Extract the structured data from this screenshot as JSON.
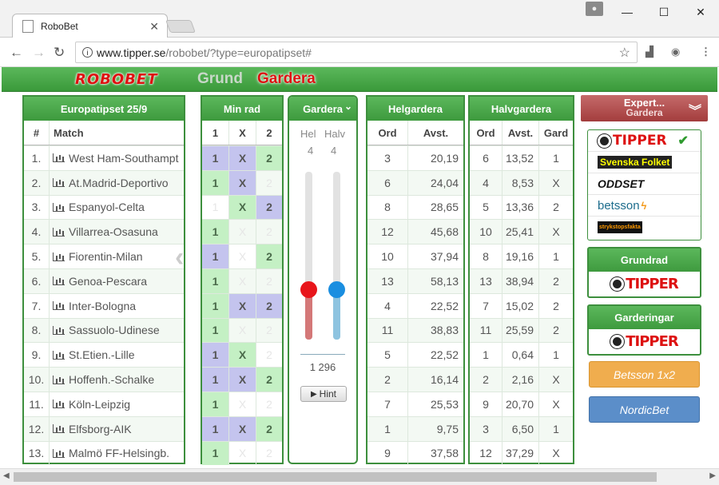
{
  "browser": {
    "tab_title": "RoboBet",
    "url_host": "www.tipper.se",
    "url_path": "/robobet/?type=europatipset#"
  },
  "header": {
    "logo": "ROBOBET",
    "mode_grund": "Grund",
    "mode_gardera": "Gardera"
  },
  "matches": {
    "title": "Europatipset 25/9",
    "col_num": "#",
    "col_match": "Match",
    "rows": [
      {
        "n": "1.",
        "m": "West Ham-Southampt"
      },
      {
        "n": "2.",
        "m": "At.Madrid-Deportivo"
      },
      {
        "n": "3.",
        "m": "Espanyol-Celta"
      },
      {
        "n": "4.",
        "m": "Villarrea-Osasuna"
      },
      {
        "n": "5.",
        "m": "Fiorentin-Milan"
      },
      {
        "n": "6.",
        "m": "Genoa-Pescara"
      },
      {
        "n": "7.",
        "m": "Inter-Bologna"
      },
      {
        "n": "8.",
        "m": "Sassuolo-Udinese"
      },
      {
        "n": "9.",
        "m": "St.Etien.-Lille"
      },
      {
        "n": "10.",
        "m": "Hoffenh.-Schalke"
      },
      {
        "n": "11.",
        "m": "Köln-Leipzig"
      },
      {
        "n": "12.",
        "m": "Elfsborg-AIK"
      },
      {
        "n": "13.",
        "m": "Malmö FF-Helsingb."
      }
    ]
  },
  "minrad": {
    "title": "Min rad",
    "headers": [
      "1",
      "X",
      "2"
    ],
    "rows": [
      [
        "b",
        "b",
        "g"
      ],
      [
        "g",
        "b",
        "e"
      ],
      [
        "e",
        "g",
        "b"
      ],
      [
        "g",
        "e",
        "e"
      ],
      [
        "b",
        "e",
        "g"
      ],
      [
        "g",
        "e",
        "e"
      ],
      [
        "g",
        "b",
        "b"
      ],
      [
        "g",
        "e",
        "e"
      ],
      [
        "b",
        "g",
        "e"
      ],
      [
        "b",
        "b",
        "g"
      ],
      [
        "g",
        "e",
        "e"
      ],
      [
        "b",
        "b",
        "g"
      ],
      [
        "g",
        "e",
        "e"
      ]
    ],
    "labels": [
      "1",
      "X",
      "2"
    ]
  },
  "gardera": {
    "title": "Gardera",
    "hel_label": "Hel",
    "halv_label": "Halv",
    "hel_value": "4",
    "halv_value": "4",
    "hel_level": 0.3,
    "halv_level": 0.3,
    "rows_total": "1 296",
    "hint_label": "Hint"
  },
  "helgardera": {
    "title": "Helgardera",
    "col_ord": "Ord",
    "col_avst": "Avst.",
    "rows": [
      [
        "3",
        "20,19"
      ],
      [
        "6",
        "24,04"
      ],
      [
        "8",
        "28,65"
      ],
      [
        "12",
        "45,68"
      ],
      [
        "10",
        "37,94"
      ],
      [
        "13",
        "58,13"
      ],
      [
        "4",
        "22,52"
      ],
      [
        "11",
        "38,83"
      ],
      [
        "5",
        "22,52"
      ],
      [
        "2",
        "16,14"
      ],
      [
        "7",
        "25,53"
      ],
      [
        "1",
        "9,75"
      ],
      [
        "9",
        "37,58"
      ]
    ]
  },
  "halvgardera": {
    "title": "Halvgardera",
    "col_ord": "Ord",
    "col_avst": "Avst.",
    "col_gard": "Gard",
    "rows": [
      [
        "6",
        "13,52",
        "1"
      ],
      [
        "4",
        "8,53",
        "X"
      ],
      [
        "5",
        "13,36",
        "2"
      ],
      [
        "10",
        "25,41",
        "X"
      ],
      [
        "8",
        "19,16",
        "1"
      ],
      [
        "13",
        "38,94",
        "2"
      ],
      [
        "7",
        "15,02",
        "2"
      ],
      [
        "11",
        "25,59",
        "2"
      ],
      [
        "1",
        "0,64",
        "1"
      ],
      [
        "2",
        "2,16",
        "X"
      ],
      [
        "9",
        "20,70",
        "X"
      ],
      [
        "3",
        "6,50",
        "1"
      ],
      [
        "12",
        "37,29",
        "X"
      ]
    ]
  },
  "sidebar": {
    "expert_line1": "Expert...",
    "expert_line2": "Gardera",
    "logos": [
      "TIPPER",
      "Svenska Folket",
      "ODDSET",
      "betsson",
      "strykstopsfakta"
    ],
    "grundrad_title": "Grundrad",
    "gardering_title": "Garderingar",
    "tipper": "TIPPER",
    "betsson_btn": "Betsson 1x2",
    "nordic_btn": "NordicBet",
    "colors": {
      "betsson": "#f0ad4e",
      "nordic": "#5b8ec9",
      "green": "#3d8f3d"
    }
  }
}
